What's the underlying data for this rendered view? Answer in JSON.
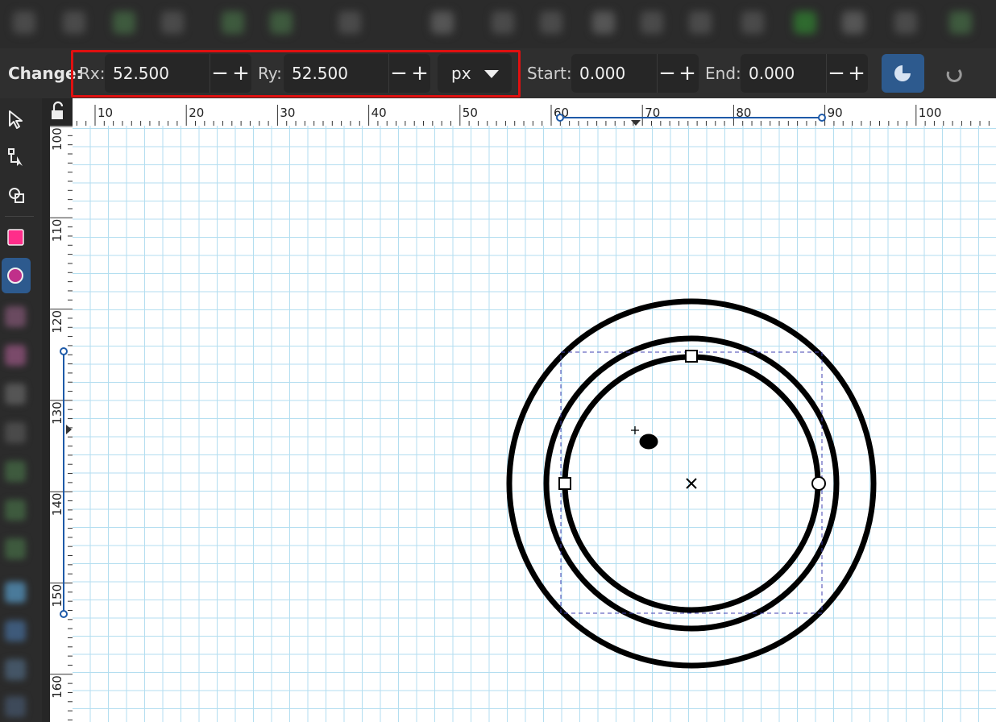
{
  "toolbar": {
    "change_label": "Change:",
    "rx_label": "Rx:",
    "rx_value": "52.500",
    "ry_label": "Ry:",
    "ry_value": "52.500",
    "unit_value": "px",
    "start_label": "Start:",
    "start_value": "0.000",
    "end_label": "End:",
    "end_value": "0.000",
    "minus": "−",
    "plus": "+"
  },
  "ruler": {
    "horizontal_ticks": [
      "10",
      "20",
      "30",
      "40",
      "50",
      "60",
      "70",
      "80",
      "90",
      "100"
    ],
    "vertical_ticks": [
      "100",
      "110",
      "120",
      "130",
      "140",
      "150",
      "160"
    ]
  },
  "tools": [
    "selector-tool",
    "node-tool",
    "shape-builder-tool",
    "rectangle-tool",
    "ellipse-tool"
  ],
  "colors": {
    "highlight": "#e01010",
    "grid": "#b3def0",
    "active_button": "#2d5a8e",
    "rect_tool": "#ff2d8a",
    "ellipse_tool": "#c0308a",
    "selection_box": "#4040b0",
    "ruler_marker": "#1e5aa8"
  }
}
